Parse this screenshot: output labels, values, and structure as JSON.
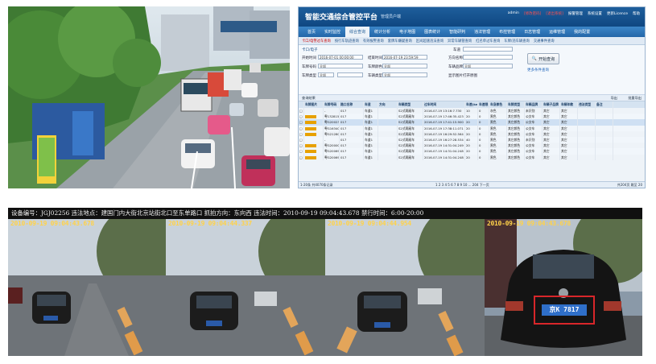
{
  "app": {
    "title": "智能交通综合管控平台",
    "user": "管理员户端",
    "links": [
      "admin",
      "[修改密码]",
      "[退出系统]",
      "报警管理",
      "系统设置",
      "更新Licence",
      "帮助"
    ]
  },
  "nav": [
    "首页",
    "实时监控",
    "综合查询",
    "统计分析",
    "电子地图",
    "图表统计",
    "智能研判",
    "违法管理",
    "布控管理",
    "日志管理",
    "运维管理",
    "我的配置"
  ],
  "nav_active": 2,
  "subnav": [
    "卡口/电警过车查询",
    "按行车轨迹查询",
    "有效报警查询",
    "套牌车嫌疑查询",
    "区间超速违法查询",
    "异常车辆管查询",
    "红名单过车查询",
    "车牌/违车辆查询",
    "交通事件查询"
  ],
  "filter": {
    "section": "卡口/电子",
    "start_label": "开始时间",
    "start_value": "2016-07-01 00:00:00",
    "end_label": "结束时间",
    "end_value": "2016-07-19 23:59:59",
    "lane_label": "车道",
    "lane_value": "",
    "plate_label": "车牌号码",
    "plate_value": "全部",
    "plate_color_label": "车牌颜色",
    "plate_color_value": "全部",
    "dir_label": "方向名称",
    "dir_value": "",
    "type_label": "车牌类型",
    "type_value": "全部",
    "vtype_label": "车辆类型",
    "vtype_value": "全部",
    "brand_label": "车辆品牌",
    "brand_value": "全部",
    "query_btn": "开始查询",
    "more_link": "更多条件查询",
    "pic_label": "显示图片",
    "pic_option": "打开原图"
  },
  "toolbar": {
    "left": "查询结果",
    "right1": "导出",
    "right2": "批量导出"
  },
  "columns": [
    "",
    "车牌图片",
    "车牌号码",
    "路口名称",
    "车道",
    "方向",
    "车辆类型",
    "过车时间",
    "车速(km/h)",
    "车速限",
    "车身颜色",
    "车牌类型",
    "车辆品牌",
    "车辆子品牌",
    "车辆年款",
    "违法类型",
    "备注"
  ],
  "rows": [
    {
      "plate": "-",
      "road": "017",
      "lane": "车道1",
      "dir": "",
      "vtype": "S2式两厢车",
      "time": "2016-07-19 13:16:7.730",
      "speed": "10",
      "limit": "0",
      "color": "灰色",
      "ptype": "其它颜色",
      "brand": "未识别",
      "sub": "其它",
      "year": "其它",
      "img": false
    },
    {
      "plate": "粤132815",
      "road": "017",
      "lane": "车道1",
      "dir": "",
      "vtype": "S2式两厢车",
      "time": "2016-07-19 17:46:35.423",
      "speed": "20",
      "limit": "0",
      "color": "黑色",
      "ptype": "其它颜色",
      "brand": "公交车",
      "sub": "其它",
      "year": "其它",
      "img": true
    },
    {
      "plate": "粤G20023",
      "road": "017",
      "lane": "车道1",
      "dir": "",
      "vtype": "S2式两厢车",
      "time": "2016-07-19 17:41:15.900",
      "speed": "20",
      "limit": "0",
      "color": "黑色",
      "ptype": "其它颜色",
      "brand": "公交车",
      "sub": "其它",
      "year": "其它",
      "img": true
    },
    {
      "plate": "粤G16340",
      "road": "017",
      "lane": "车道1",
      "dir": "",
      "vtype": "S2式两厢车",
      "time": "2016-07-19 17:38:11.071",
      "speed": "20",
      "limit": "0",
      "color": "黑色",
      "ptype": "其它颜色",
      "brand": "公交车",
      "sub": "其它",
      "year": "其它",
      "img": true
    },
    {
      "plate": "粤G21280",
      "road": "017",
      "lane": "车道1",
      "dir": "",
      "vtype": "S2式两厢车",
      "time": "2016-07-19 16:29:52.564",
      "speed": "20",
      "limit": "0",
      "color": "黑色",
      "ptype": "其它颜色",
      "brand": "公交车",
      "sub": "其它",
      "year": "其它",
      "img": true
    },
    {
      "plate": "-",
      "road": "017",
      "lane": "车道1",
      "dir": "",
      "vtype": "S2式两厢车",
      "time": "2016-07-19 16:27:28.534",
      "speed": "40",
      "limit": "0",
      "color": "黑色",
      "ptype": "其它颜色",
      "brand": "未识别",
      "sub": "其它",
      "year": "其它",
      "img": false
    },
    {
      "plate": "粤G20000",
      "road": "017",
      "lane": "车道1",
      "dir": "",
      "vtype": "S2式两厢车",
      "time": "2016-07-19 14:31:04.249",
      "speed": "20",
      "limit": "0",
      "color": "黑色",
      "ptype": "其它颜色",
      "brand": "公交车",
      "sub": "其它",
      "year": "其它",
      "img": true
    },
    {
      "plate": "粤G20069",
      "road": "017",
      "lane": "车道1",
      "dir": "",
      "vtype": "S2式两厢车",
      "time": "2016-07-19 14:31:04.248",
      "speed": "20",
      "limit": "0",
      "color": "黑色",
      "ptype": "其它颜色",
      "brand": "公交车",
      "sub": "其它",
      "year": "其它",
      "img": true
    },
    {
      "plate": "粤G20069",
      "road": "017",
      "lane": "车道1",
      "dir": "",
      "vtype": "S2式两厢车",
      "time": "2016-07-19 14:31:04.248",
      "speed": "20",
      "limit": "0",
      "color": "黑色",
      "ptype": "其它颜色",
      "brand": "公交车",
      "sub": "其它",
      "year": "其它",
      "img": true
    }
  ],
  "pager": {
    "left": "1-20条 共4070条记录",
    "pages": "1 2 3 4 5 6 7 8 9 10 ... 204 下一页",
    "right": "共204页 跳至 20"
  },
  "bottom": {
    "caption": "设备编号：JGJ02256  违法地点：建国门内大街北京站街北口至东单路口  抓拍方向：东向西  违法时间：2010-09-19 09:04:43.678  禁行时间：6:00-20:00",
    "timestamps": [
      "2010-09-19 09:04:43.678",
      "2010-09-19 09:04:44.337",
      "2010-09-19 09:04:44.954",
      "2010-09-19 09:04:43.678"
    ],
    "plate_text": "京K 7817"
  },
  "photo": {
    "bus_stop_label": ""
  }
}
